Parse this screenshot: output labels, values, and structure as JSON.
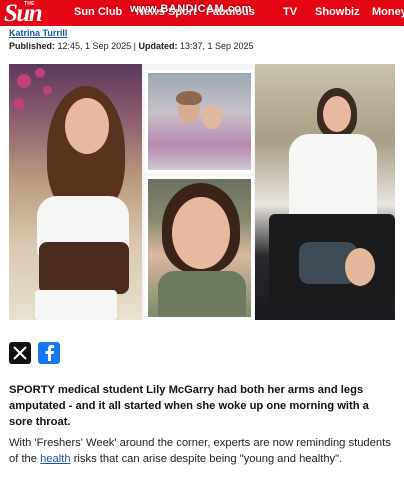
{
  "site": {
    "logo_small": "THE",
    "logo_main": "Sun",
    "brand_color": "#e30613"
  },
  "nav": {
    "items": [
      "Sun Club",
      "News",
      "Sport",
      "Fabulous",
      "TV",
      "Showbiz",
      "Money"
    ]
  },
  "recording_watermark": "www.BANDICAM.com",
  "byline": {
    "author": "Katrina Turrill",
    "published_label": "Published:",
    "published_time": "12:45, 1 Sep 2025",
    "separator": "|",
    "updated_label": "Updated:",
    "updated_time": "13:37, 1 Sep 2025"
  },
  "share": {
    "icons": [
      "x-icon",
      "facebook-icon"
    ]
  },
  "article": {
    "lead": "SPORTY medical student Lily McGarry had both her arms and legs amputated - and it all started when she woke up one morning with a sore throat.",
    "body_before": "With 'Freshers' Week' around the corner, experts are now reminding students of the ",
    "body_link": "health",
    "body_after": " risks that can arise despite being \"young and healthy\"."
  }
}
